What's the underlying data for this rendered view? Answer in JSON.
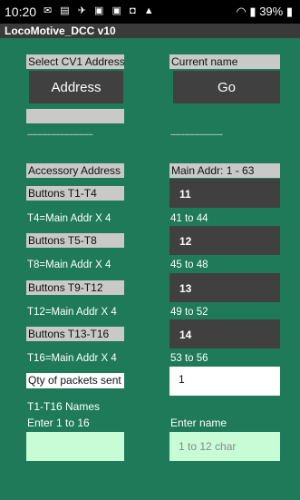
{
  "status_bar": {
    "time": "10:20",
    "icons": [
      "message-icon",
      "news-icon",
      "running-icon",
      "app-icon",
      "app-icon",
      "nfc-icon",
      "warning-icon"
    ],
    "battery": "39%"
  },
  "app": {
    "title": "LocoMotive_DCC v10"
  },
  "left_column": {
    "select_cv1_label": "Select CV1 Address",
    "address_button": "Address",
    "dashes": "-----------------------------",
    "accessory_address_label": "Accessory Address",
    "buttons_t1_t4": "Buttons T1-T4",
    "t4_formula": "T4=Main Addr X 4",
    "buttons_t5_t8": "Buttons T5-T8",
    "t8_formula": "T8=Main Addr X 4",
    "buttons_t9_t12": "Buttons T9-T12",
    "t12_formula": "T12=Main Addr X 4",
    "buttons_t13_t16": "Buttons T13-T16",
    "t16_formula": "T16=Main Addr X 4",
    "qty_packets_label": "Qty of packets sent",
    "names_heading": "T1-T16 Names",
    "enter_range": "Enter 1 to 16",
    "index_input": {
      "value": "",
      "placeholder": ""
    }
  },
  "right_column": {
    "current_name_label": "Current name",
    "go_button": "Go",
    "dashes": "-----------------------",
    "main_addr_label": "Main Addr: 1 - 63",
    "addr_11": "11",
    "range_41_44": "41 to 44",
    "addr_12": "12",
    "range_45_48": "45 to 48",
    "addr_13": "13",
    "range_49_52": "49 to 52",
    "addr_14": "14",
    "range_53_56": "53 to 56",
    "qty_value": "1",
    "enter_name_label": "Enter name",
    "name_input": {
      "value": "",
      "placeholder": "1 to 12 char"
    }
  }
}
